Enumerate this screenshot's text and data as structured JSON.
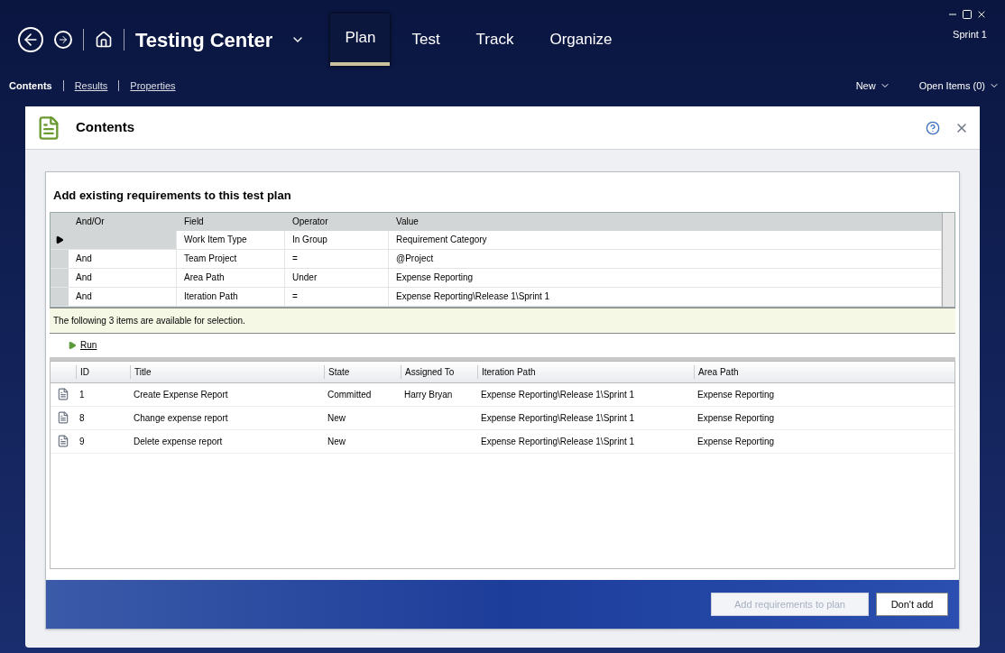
{
  "app_title": "Testing Center",
  "tabs": [
    {
      "label": "Plan",
      "selected": true
    },
    {
      "label": "Test",
      "selected": false
    },
    {
      "label": "Track",
      "selected": false
    },
    {
      "label": "Organize",
      "selected": false
    }
  ],
  "sprint": "Sprint 1",
  "subtabs": [
    {
      "label": "Contents",
      "selected": true
    },
    {
      "label": "Results",
      "selected": false
    },
    {
      "label": "Properties",
      "selected": false
    }
  ],
  "toolbar_right": [
    {
      "label": "New"
    },
    {
      "label": "Open Items (0)"
    }
  ],
  "panel_title": "Contents",
  "dialog": {
    "title": "Add existing requirements to this test plan",
    "query": {
      "columns": [
        "And/Or",
        "Field",
        "Operator",
        "Value"
      ],
      "rows": [
        {
          "current": true,
          "cells": [
            "",
            "Work Item Type",
            "In Group",
            "Requirement Category"
          ]
        },
        {
          "current": false,
          "cells": [
            "And",
            "Team Project",
            "=",
            "@Project"
          ]
        },
        {
          "current": false,
          "cells": [
            "And",
            "Area Path",
            "Under",
            "Expense Reporting"
          ]
        },
        {
          "current": false,
          "cells": [
            "And",
            "Iteration Path",
            "=",
            "Expense Reporting\\Release 1\\Sprint 1"
          ]
        }
      ]
    },
    "info": "The following 3 items are available for selection.",
    "run_button": "Run",
    "results": {
      "columns": [
        "ID",
        "Title",
        "State",
        "Assigned To",
        "Iteration Path",
        "Area Path"
      ],
      "rows": [
        [
          "1",
          "Create Expense Report",
          "Committed",
          "Harry Bryan",
          "Expense Reporting\\Release 1\\Sprint 1",
          "Expense Reporting"
        ],
        [
          "8",
          "Change expense report",
          "New",
          "",
          "Expense Reporting\\Release 1\\Sprint 1",
          "Expense Reporting"
        ],
        [
          "9",
          "Delete expense report",
          "New",
          "",
          "Expense Reporting\\Release 1\\Sprint 1",
          "Expense Reporting"
        ]
      ]
    },
    "buttons": [
      {
        "label": "Add requirements to plan",
        "disabled": true
      },
      {
        "label": "Don't add",
        "disabled": false
      }
    ]
  }
}
